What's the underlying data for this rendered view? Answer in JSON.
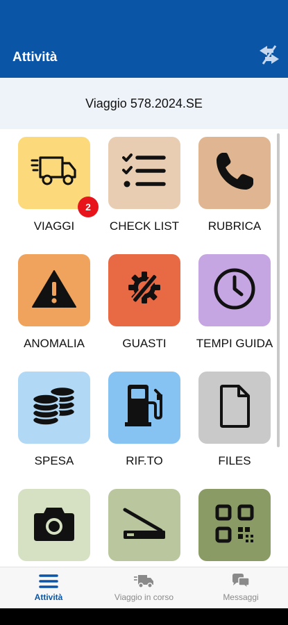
{
  "header": {
    "title": "Attività",
    "sync_icon": "sync-arrows-icon"
  },
  "trip": {
    "label": "Viaggio 578.2024.SE"
  },
  "tiles": [
    {
      "label": "VIAGGI",
      "icon": "truck-icon",
      "color": "#fcd97a",
      "badge": "2"
    },
    {
      "label": "CHECK LIST",
      "icon": "checklist-icon",
      "color": "#e8cdb2"
    },
    {
      "label": "RUBRICA",
      "icon": "phone-icon",
      "color": "#dfb691"
    },
    {
      "label": "ANOMALIA",
      "icon": "warning-icon",
      "color": "#f0a35c"
    },
    {
      "label": "GUASTI",
      "icon": "tools-gear-icon",
      "color": "#e86a44"
    },
    {
      "label": "TEMPI GUIDA",
      "icon": "clock-icon",
      "color": "#c6a6e2"
    },
    {
      "label": "SPESA",
      "icon": "coins-icon",
      "color": "#b1d8f4"
    },
    {
      "label": "RIF.TO",
      "icon": "fuel-pump-icon",
      "color": "#86c2f2"
    },
    {
      "label": "FILES",
      "icon": "file-icon",
      "color": "#c9c9c9"
    },
    {
      "label": "",
      "icon": "camera-icon",
      "color": "#d6e1c4"
    },
    {
      "label": "",
      "icon": "scanner-icon",
      "color": "#b9c69e"
    },
    {
      "label": "",
      "icon": "qr-code-icon",
      "color": "#8a9b66"
    }
  ],
  "bottom_nav": [
    {
      "label": "Attività",
      "icon": "hamburger-menu-icon",
      "active": true
    },
    {
      "label": "Viaggio in corso",
      "icon": "truck-icon",
      "active": false
    },
    {
      "label": "Messaggi",
      "icon": "chat-bubbles-icon",
      "active": false
    }
  ],
  "colors": {
    "primary": "#0b55a6",
    "badge": "#e8141c"
  }
}
